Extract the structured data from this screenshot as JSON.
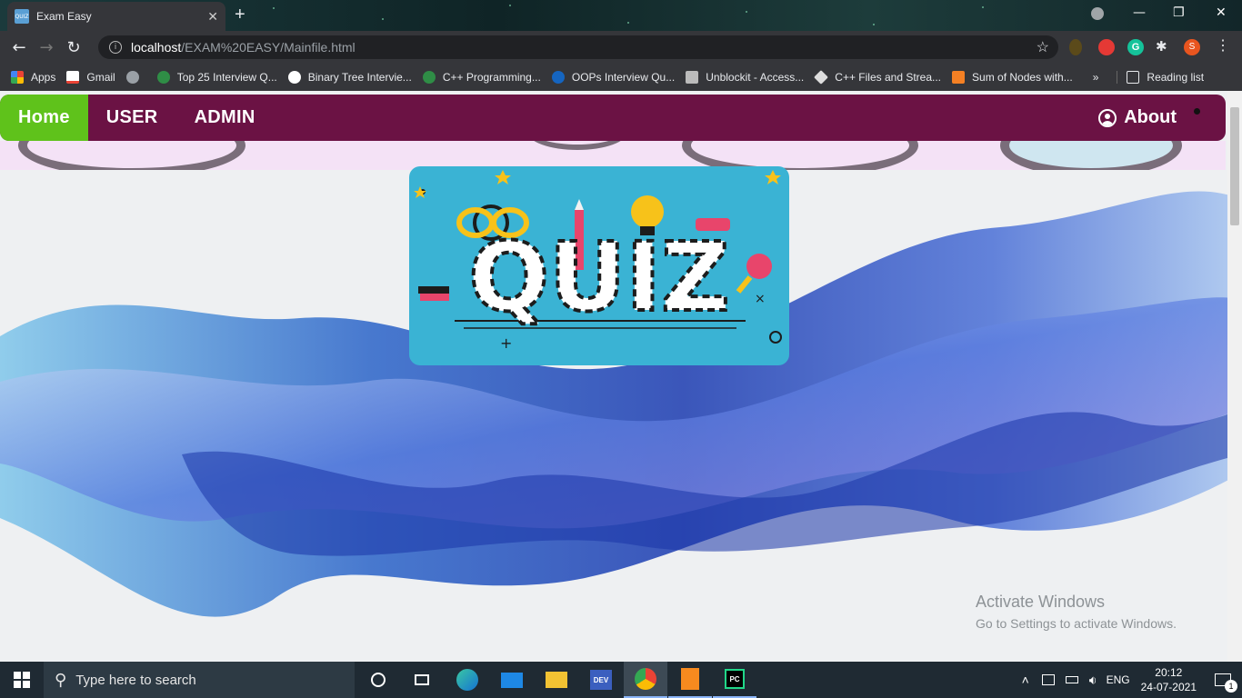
{
  "browser": {
    "tab_title": "Exam Easy",
    "tab_favicon_text": "QUIZ",
    "url_host": "localhost",
    "url_path": "/EXAM%20EASY/Mainfile.html",
    "profile_initial": "S"
  },
  "bookmarks": [
    {
      "label": "Apps",
      "icon": "apps-grid-icon",
      "color": "#f4b400"
    },
    {
      "label": "Gmail",
      "icon": "gmail-icon",
      "color": "#ea4335"
    },
    {
      "label": "",
      "icon": "globe-icon",
      "color": "#9aa0a6"
    },
    {
      "label": "Top 25 Interview Q...",
      "icon": "gfg-icon",
      "color": "#2f8d46"
    },
    {
      "label": "Binary Tree Intervie...",
      "icon": "interviewbit-icon",
      "color": "#ffffff"
    },
    {
      "label": "C++ Programming...",
      "icon": "gfg-icon",
      "color": "#2f8d46"
    },
    {
      "label": "OOPs Interview Qu...",
      "icon": "e-icon",
      "color": "#1565c0"
    },
    {
      "label": "Unblockit - Access...",
      "icon": "ub-icon",
      "color": "#bbbbbb"
    },
    {
      "label": "C++ Files and Strea...",
      "icon": "diamond-icon",
      "color": "#dddddd"
    },
    {
      "label": "Sum of Nodes with...",
      "icon": "stack-icon",
      "color": "#f48024"
    }
  ],
  "bookmarks_overflow": "»",
  "reading_list": "Reading list",
  "nav": {
    "home": "Home",
    "user": "USER",
    "admin": "ADMIN",
    "about": "About"
  },
  "hero": {
    "logo_text": "QUIZ"
  },
  "watermark": {
    "title": "Activate Windows",
    "subtitle": "Go to Settings to activate Windows."
  },
  "taskbar": {
    "search_placeholder": "Type here to search",
    "language": "ENG",
    "time": "20:12",
    "date": "24-07-2021",
    "notification_count": "1"
  },
  "colors": {
    "navbar": "#6b1244",
    "home_active": "#5fc21b",
    "quiz_card": "#3ab3d4"
  }
}
